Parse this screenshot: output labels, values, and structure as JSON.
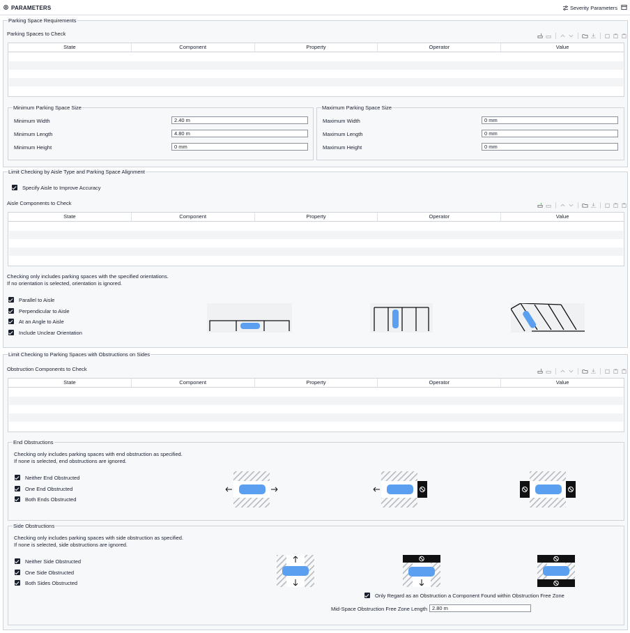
{
  "header": {
    "title": "PARAMETERS",
    "severity_label": "Severity Parameters"
  },
  "columns": [
    "State",
    "Component",
    "Property",
    "Operator",
    "Value"
  ],
  "parking": {
    "group_title": "Parking Space Requirements",
    "table_title": "Parking Spaces to Check",
    "min": {
      "title": "Minimum Parking Space Size",
      "width_label": "Minimum Width",
      "width_value": "2.40 m",
      "length_label": "Minimum Length",
      "length_value": "4.80 m",
      "height_label": "Minimum Height",
      "height_value": "0 mm"
    },
    "max": {
      "title": "Maximum Parking Space Size",
      "width_label": "Maximum Width",
      "width_value": "0 mm",
      "length_label": "Maximum Length",
      "length_value": "0 mm",
      "height_label": "Maximum Height",
      "height_value": "0 mm"
    }
  },
  "aisle": {
    "group_title": "Limit Checking by Aisle Type and Parking Space Alignment",
    "specify_label": "Specify Aisle to Improve Accuracy",
    "table_title": "Aisle Components to Check",
    "info_line1": "Checking only includes parking spaces with the specified orientations.",
    "info_line2": "If no orientation is selected, orientation is ignored.",
    "options": [
      "Parallel to Aisle",
      "Perpendicular to Aisle",
      "At an Angle to Aisle",
      "Include Unclear Orientation"
    ]
  },
  "obstruction": {
    "group_title": "Limit Checking to Parking Spaces with Obstructions on Sides",
    "table_title": "Obstruction Components to Check",
    "end": {
      "title": "End Obstructions",
      "info_line1": "Checking only includes parking spaces with end obstruction as specified.",
      "info_line2": "If none is selected, end obstructions are ignored.",
      "options": [
        "Neither End Obstructed",
        "One End Obstructed",
        "Both Ends Obstructed"
      ]
    },
    "side": {
      "title": "Side Obstructions",
      "info_line1": "Checking only includes parking spaces with side obstruction as specified.",
      "info_line2": "If none is selected, side obstructions are ignored.",
      "options": [
        "Neither Side Obstructed",
        "One Side Obstructed",
        "Both Sides Obstructed"
      ],
      "free_zone_label": "Only Regard as an Obstruction a Component Found within Obstruction Free Zone",
      "mid_label": "Mid-Space Obstruction Free Zone Length",
      "mid_value": "2.80 m"
    }
  },
  "colors": {
    "car": "#5b9ff0",
    "text": "#1a1f2e",
    "border": "#cfd4db"
  }
}
